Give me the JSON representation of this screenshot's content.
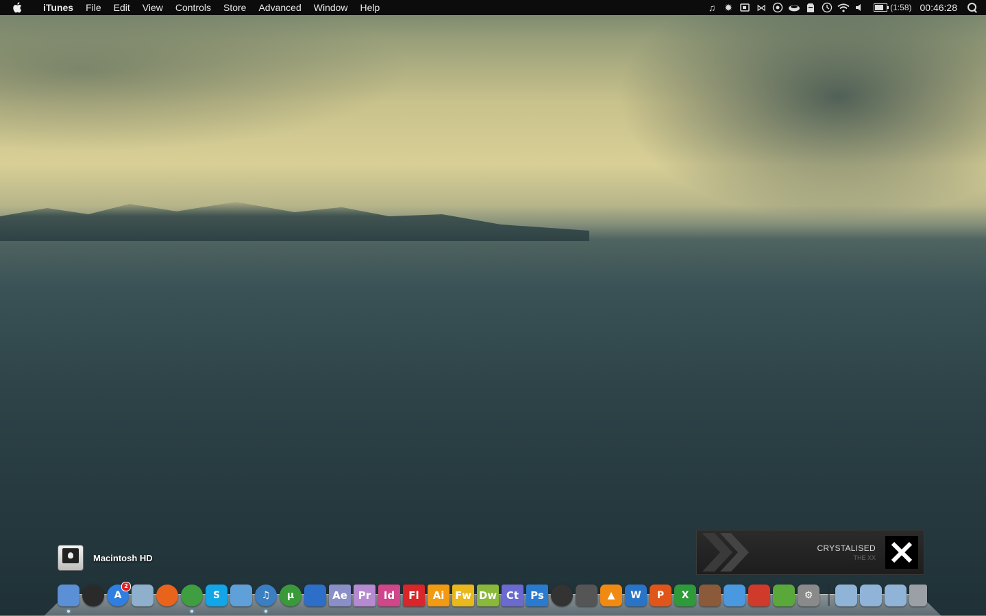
{
  "menubar": {
    "app_name": "iTunes",
    "menus": [
      "File",
      "Edit",
      "View",
      "Controls",
      "Store",
      "Advanced",
      "Window",
      "Help"
    ],
    "tray_icons": [
      "music-note-icon",
      "gear-sun-icon",
      "display-icon",
      "bowtie-icon",
      "growl-icon",
      "cloud-icon",
      "evernote-icon",
      "time-machine-icon",
      "wifi-icon",
      "volume-icon"
    ],
    "battery": {
      "text": "(1:58)",
      "level": 0.75
    },
    "clock": "00:46:28"
  },
  "desktop": {
    "drive_label": "Macintosh HD"
  },
  "now_playing": {
    "title": "CRYSTALISED",
    "artist": "THE XX"
  },
  "dock": {
    "apps": [
      {
        "name": "finder-icon",
        "label": "",
        "color": "#5b8fd6"
      },
      {
        "name": "dashboard-icon",
        "label": "",
        "color": "#2a2a2a"
      },
      {
        "name": "app-store-icon",
        "label": "A",
        "color": "#2f7fe0",
        "badge": "2"
      },
      {
        "name": "preview-icon",
        "label": "",
        "color": "#8fb0cc"
      },
      {
        "name": "firefox-icon",
        "label": "",
        "color": "#e8641c"
      },
      {
        "name": "chrome-icon",
        "label": "",
        "color": "#3f9e3f"
      },
      {
        "name": "skype-icon",
        "label": "S",
        "color": "#12a5e8"
      },
      {
        "name": "messenger-icon",
        "label": "",
        "color": "#5fa0d8"
      },
      {
        "name": "itunes-icon",
        "label": "♫",
        "color": "#3a7fc2"
      },
      {
        "name": "utorrent-icon",
        "label": "µ",
        "color": "#3a9a3a"
      },
      {
        "name": "adium-icon",
        "label": "",
        "color": "#2d6ec8"
      },
      {
        "name": "after-effects-icon",
        "label": "Ae",
        "color": "#8a8fc8"
      },
      {
        "name": "premiere-icon",
        "label": "Pr",
        "color": "#b68ad0"
      },
      {
        "name": "indesign-icon",
        "label": "Id",
        "color": "#d0468a"
      },
      {
        "name": "flash-icon",
        "label": "Fl",
        "color": "#d8262a"
      },
      {
        "name": "illustrator-icon",
        "label": "Ai",
        "color": "#f29a12"
      },
      {
        "name": "fireworks-icon",
        "label": "Fw",
        "color": "#e8b81c"
      },
      {
        "name": "dreamweaver-icon",
        "label": "Dw",
        "color": "#8ab83a"
      },
      {
        "name": "contribute-icon",
        "label": "Ct",
        "color": "#6a6ad0"
      },
      {
        "name": "photoshop-icon",
        "label": "Ps",
        "color": "#2a7ad0"
      },
      {
        "name": "aperture-icon",
        "label": "",
        "color": "#333333"
      },
      {
        "name": "final-cut-icon",
        "label": "",
        "color": "#555555"
      },
      {
        "name": "vlc-icon",
        "label": "▲",
        "color": "#f08a12"
      },
      {
        "name": "word-icon",
        "label": "W",
        "color": "#2a74c8"
      },
      {
        "name": "powerpoint-icon",
        "label": "P",
        "color": "#e0561a"
      },
      {
        "name": "excel-icon",
        "label": "X",
        "color": "#2e9a3a"
      },
      {
        "name": "coconut-icon",
        "label": "",
        "color": "#8a5a3a"
      },
      {
        "name": "dropbox-icon",
        "label": "",
        "color": "#4a98e0"
      },
      {
        "name": "pdf-icon",
        "label": "",
        "color": "#d03a2a"
      },
      {
        "name": "evernote-dock-icon",
        "label": "",
        "color": "#5aa83a"
      },
      {
        "name": "system-preferences-icon",
        "label": "⚙",
        "color": "#8a8a8a"
      }
    ],
    "stacks": [
      {
        "name": "documents-folder-icon",
        "color": "#8fb4d8"
      },
      {
        "name": "applications-folder-icon",
        "color": "#8fb4d8"
      },
      {
        "name": "downloads-folder-icon",
        "color": "#8fb4d8"
      },
      {
        "name": "trash-icon",
        "color": "#9aa0a6"
      }
    ]
  }
}
